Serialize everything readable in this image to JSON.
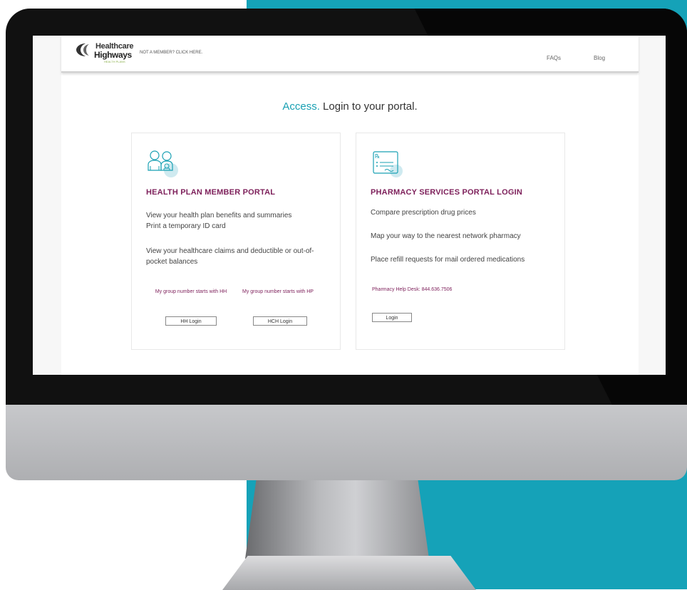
{
  "colors": {
    "teal": "#15a2b8",
    "brand_purple": "#7d1f5a",
    "accent": "#19a0b3"
  },
  "header": {
    "logo_line1": "Healthcare",
    "logo_line2": "Highways",
    "logo_line3": "HEALTH PLANS",
    "not_member": "NOT A MEMBER? CLICK HERE.",
    "nav": {
      "faqs": "FAQs",
      "blog": "Blog"
    }
  },
  "headline": {
    "accent": "Access.",
    "rest": " Login to your portal."
  },
  "member_card": {
    "icon": "family-icon",
    "title": "HEALTH PLAN MEMBER PORTAL",
    "line1": "View your health plan benefits and summaries",
    "line2": "Print a temporary ID card",
    "line3": "View your healthcare claims and deductible or out-of-pocket balances",
    "hh_note": "My group number starts with HH",
    "hp_note": "My group number starts with HP",
    "hh_button": "HH Login",
    "hch_button": "HCH Login"
  },
  "pharmacy_card": {
    "icon": "prescription-icon",
    "title": "PHARMACY SERVICES PORTAL LOGIN",
    "line1": "Compare prescription drug prices",
    "line2": "Map your way to the nearest network pharmacy",
    "line3": "Place refill requests for mail ordered medications",
    "help_desk": "Pharmacy Help Desk: 844.636.7506",
    "login_button": "Login"
  }
}
